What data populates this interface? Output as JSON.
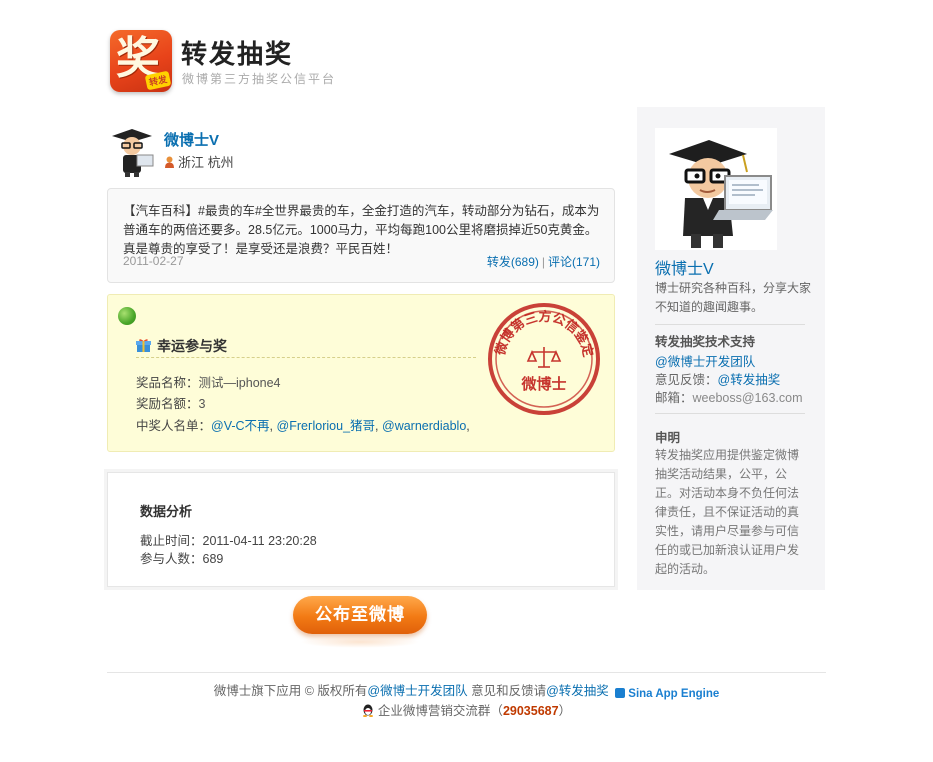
{
  "header": {
    "logo_char": "奖",
    "logo_tag": "转发",
    "title": "转发抽奖",
    "subtitle": "微博第三方抽奖公信平台"
  },
  "user": {
    "name": "微博士V",
    "location": "浙江 杭州"
  },
  "post": {
    "text": "【汽车百科】#最贵的车#全世界最贵的车，全金打造的汽车，转动部分为钻石，成本为普通车的两倍还要多。28.5亿元。1000马力，平均每跑100公里将磨损掉近50克黄金。真是尊贵的享受了！是享受还是浪费？平民百姓！",
    "date": "2011-02-27",
    "repost_label": "转发(689)",
    "comment_label": "评论(171)",
    "separator": "|"
  },
  "prize": {
    "title": "幸运参与奖",
    "name_label": "奖品名称：",
    "name_value": "测试—iphone4",
    "count_label": "奖励名额：",
    "count_value": "3",
    "winners_label": "中奖人名单：",
    "winners": [
      "@V-C不再",
      "@Frегloriou_猪哥",
      "@warnerdiablo"
    ],
    "winner_sep": ",",
    "seal_text": "微博第三方公信鉴定",
    "seal_center": "微博士"
  },
  "data_analysis": {
    "title": "数据分析",
    "deadline_label": "截止时间：",
    "deadline_value": "2011-04-11 23:20:28",
    "participants_label": "参与人数：",
    "participants_value": "689"
  },
  "publish_button": "公布至微博",
  "sidebar": {
    "name": "微博士V",
    "desc": "博士研究各种百科，分享大家不知道的趣闻趣事。",
    "support_title": "转发抽奖技术支持",
    "team_link": "@微博士开发团队",
    "feedback_label": "意见反馈：",
    "feedback_link": "@转发抽奖",
    "email_label": "邮箱：",
    "email_value": "weeboss@163.com",
    "statement_title": "申明",
    "statement_text": "转发抽奖应用提供鉴定微博抽奖活动结果，公平，公正。对活动本身不负任何法律责任，且不保证活动的真实性，请用户尽量参与可信任的或已加新浪认证用户发起的活动。"
  },
  "footer": {
    "text1": "微博士旗下应用 © 版权所有",
    "team_link": "@微博士开发团队",
    "text2": " 意见和反馈请",
    "feedback_link": "@转发抽奖",
    "sae_label": "Sina App Engine",
    "group_label": "企业微博营销交流群（",
    "group_number": "29035687",
    "group_close": "）"
  },
  "colors": {
    "link": "#0a6fb0",
    "logo": "#e8431a",
    "prize_bg": "#fefdd8",
    "button": "#f27a14",
    "seal": "#c0201c"
  }
}
